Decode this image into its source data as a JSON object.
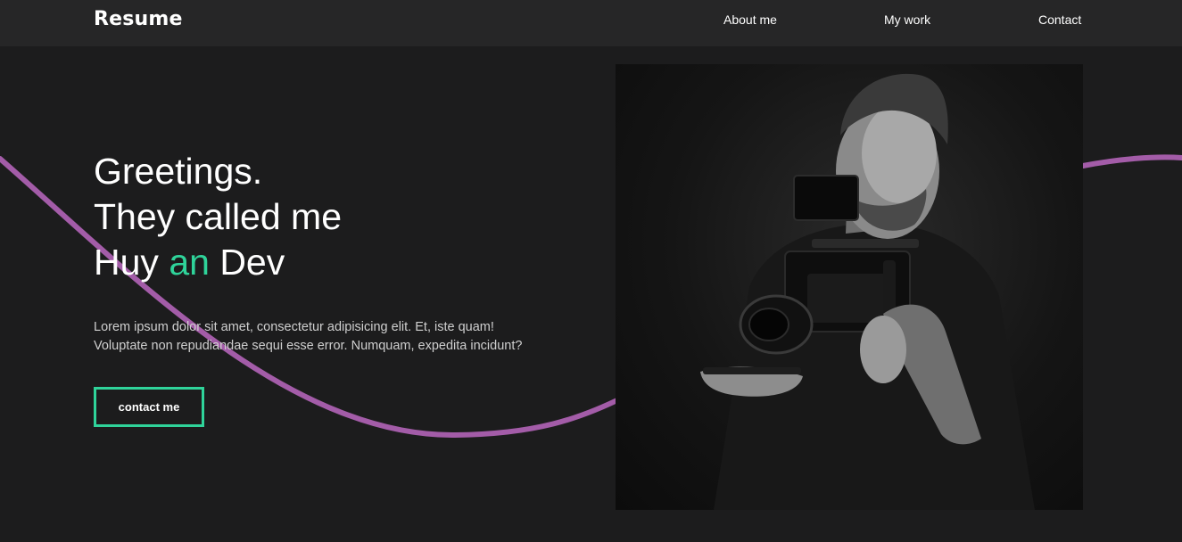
{
  "nav": {
    "logo": "Resume",
    "links": [
      "About me",
      "My work",
      "Contact"
    ]
  },
  "hero": {
    "line1": "Greetings.",
    "line2": "They called me",
    "line3_pre": "Huy ",
    "line3_accent": "an",
    "line3_post": " Dev",
    "intro_line1": "Lorem ipsum dolor sit amet, consectetur adipisicing elit. Et, iste quam!",
    "intro_line2": "Voluptate non repudiandae sequi esse error. Numquam, expedita incidunt?",
    "cta_label": "contact me"
  },
  "colors": {
    "background": "#1c1c1d",
    "navbar": "#262627",
    "accent": "#2fd39a",
    "wave": "#a35ca8"
  }
}
